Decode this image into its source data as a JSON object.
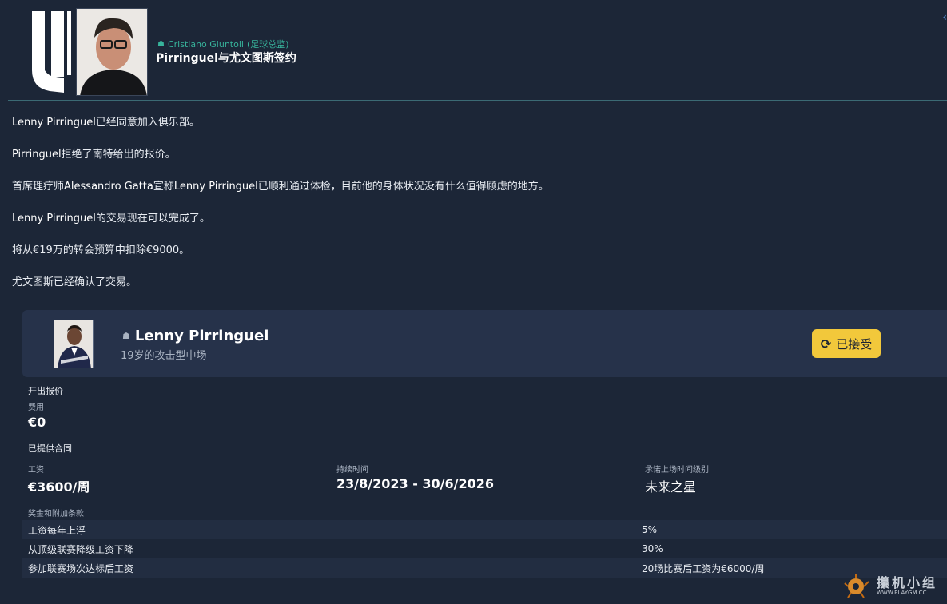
{
  "header": {
    "sender_name": "Cristiano Giuntoli",
    "sender_role": "(足球总监)",
    "subject": "Pirringuel与尤文图斯签约"
  },
  "icons": {
    "club_logo": "juventus-logo",
    "person": "person-icon",
    "swap": "swap-icon"
  },
  "message": {
    "paragraphs": [
      {
        "link": "Lenny Pirringuel",
        "text": "已经同意加入俱乐部。"
      },
      {
        "link": "Pirringuel",
        "text": "拒绝了南特给出的报价。"
      },
      {
        "pre": "首席理疗师",
        "link": "Alessandro Gatta",
        "mid": "宣称",
        "link2": "Lenny Pirringuel",
        "text": "已顺利通过体检，目前他的身体状况没有什么值得顾虑的地方。"
      },
      {
        "link": "Lenny Pirringuel",
        "text": "的交易现在可以完成了。"
      },
      {
        "text": "将从€19万的转会预算中扣除€9000。"
      },
      {
        "text": "尤文图斯已经确认了交易。"
      }
    ]
  },
  "player": {
    "name": "Lenny Pirringuel",
    "description": "19岁的攻击型中场",
    "status_button": "已接受"
  },
  "offer": {
    "section_title": "开出报价",
    "fee_label": "费用",
    "fee_value": "€0"
  },
  "contract": {
    "section_title": "已提供合同",
    "wage_label": "工资",
    "wage_value": "€3600/周",
    "duration_label": "持续时间",
    "duration_value": "23/8/2023 - 30/6/2026",
    "playing_time_label": "承诺上场时间级别",
    "playing_time_value": "未来之星",
    "clauses_title": "奖金和附加条款",
    "clauses": [
      {
        "label": "工资每年上浮",
        "value": "5%"
      },
      {
        "label": "从顶级联赛降级工资下降",
        "value": "30%"
      },
      {
        "label": "参加联赛场次达标后工资",
        "value": "20场比赛后工资为€6000/周"
      }
    ]
  },
  "watermark": {
    "title": "攥机小组",
    "url": "WWW.PLAYGM.CC"
  },
  "colors": {
    "background": "#1c2637",
    "card": "#26324a",
    "accent_green": "#37b39b",
    "button_yellow": "#f2c83b"
  }
}
